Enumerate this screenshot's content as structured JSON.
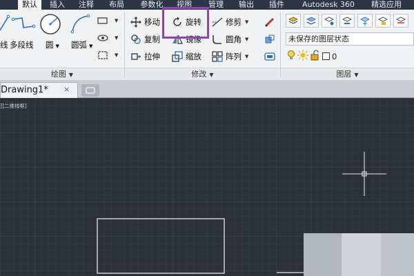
{
  "ribbon_tabs": [
    {
      "label": "默认",
      "active": true
    },
    {
      "label": "插入"
    },
    {
      "label": "注释"
    },
    {
      "label": "布局"
    },
    {
      "label": "参数化"
    },
    {
      "label": "视图"
    },
    {
      "label": "管理"
    },
    {
      "label": "输出"
    },
    {
      "label": "插件"
    },
    {
      "label": "Autodesk 360"
    },
    {
      "label": "精选应用"
    }
  ],
  "draw_panel": {
    "title": "绘图",
    "tools": {
      "line_partial": "线",
      "polyline": "多段线",
      "circle": "圆",
      "arc": "圆弧"
    }
  },
  "modify_panel": {
    "title": "修改",
    "tools": {
      "move": "移动",
      "rotate": "旋转",
      "trim": "修剪",
      "copy": "复制",
      "mirror": "镜像",
      "fillet": "圆角",
      "stretch": "拉伸",
      "scale": "缩放",
      "array": "阵列"
    }
  },
  "layers_panel": {
    "title": "图层",
    "layer_state": "未保存的图层状态",
    "current_layer": "0"
  },
  "file_tabs": [
    {
      "label": "Drawing1*",
      "close": "×"
    }
  ],
  "viewport_label": "]]二维线框]",
  "colors": {
    "accent_highlight": "#8e44ad",
    "canvas_bg": "#2b3039",
    "ribbon_tabbar": "#2d3646"
  }
}
